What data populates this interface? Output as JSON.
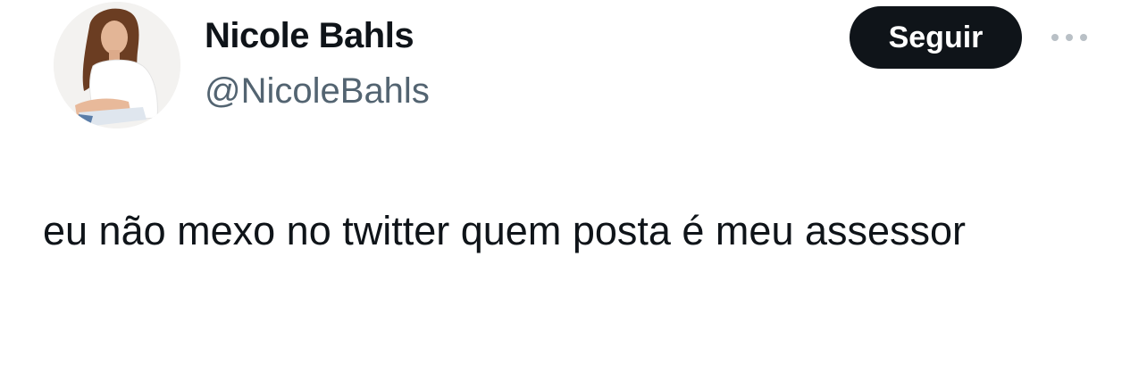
{
  "author": {
    "name": "Nicole Bahls",
    "handle": "@NicoleBahls"
  },
  "actions": {
    "follow_label": "Seguir",
    "more_icon": "more-horizontal-icon"
  },
  "tweet": {
    "text": "eu não mexo no twitter quem posta é meu assessor"
  },
  "colors": {
    "text_primary": "#0f1419",
    "text_secondary": "#536471",
    "button_bg": "#0f1419",
    "button_text": "#ffffff",
    "background": "#ffffff"
  }
}
